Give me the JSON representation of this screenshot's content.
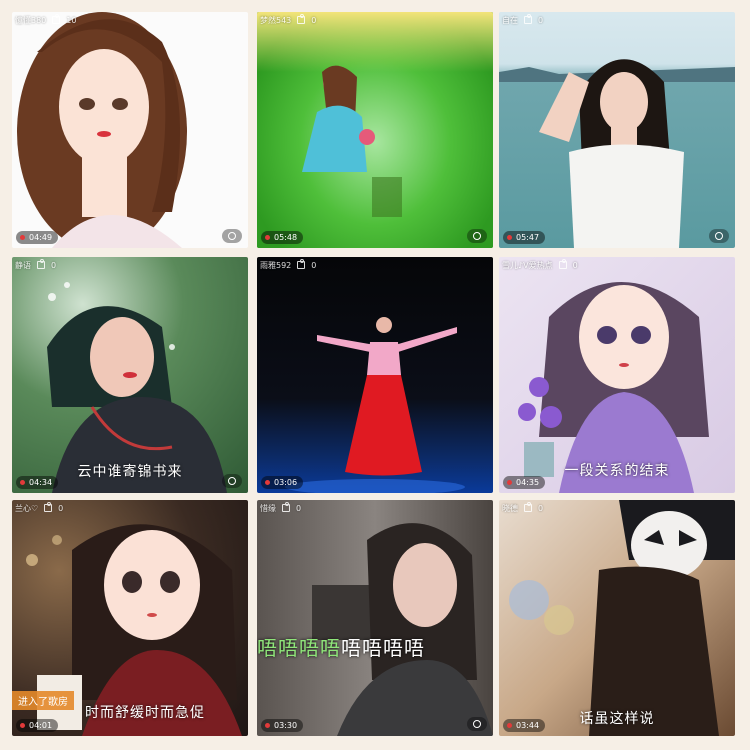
{
  "tiles": [
    {
      "user": "憶懂380",
      "gifts": "10",
      "duration": "04:49",
      "caption": ""
    },
    {
      "user": "梦然543",
      "gifts": "0",
      "duration": "05:48",
      "caption": ""
    },
    {
      "user": "自在",
      "gifts": "0",
      "duration": "05:47",
      "caption": ""
    },
    {
      "user": "静语",
      "gifts": "0",
      "duration": "04:34",
      "caption": "云中谁寄锦书来"
    },
    {
      "user": "雨雅592",
      "gifts": "0",
      "duration": "03:06",
      "caption": ""
    },
    {
      "user": "雪儿♪V爱热点",
      "gifts": "0",
      "duration": "04:35",
      "caption": "一段关系的结束"
    },
    {
      "user": "兰心♡",
      "gifts": "0",
      "duration": "04:01",
      "caption": "时而舒缓时而急促",
      "notice": "进入了歌房"
    },
    {
      "user": "惜缘",
      "gifts": "0",
      "duration": "03:30",
      "caption": "",
      "lyric_highlight": "唔唔唔唔",
      "lyric_rest": "唔唔唔唔"
    },
    {
      "user": "晓德",
      "gifts": "0",
      "duration": "03:44",
      "caption": "话虽这样说"
    }
  ],
  "icons": {
    "gift": "gift-icon",
    "record": "record-dot",
    "profile": "person-icon"
  },
  "colors": {
    "page_background": "#f6efe6",
    "record_dot": "#e23a3a",
    "lyric_highlight": "#8fe67a",
    "notice_bg": "#e48a2a"
  }
}
